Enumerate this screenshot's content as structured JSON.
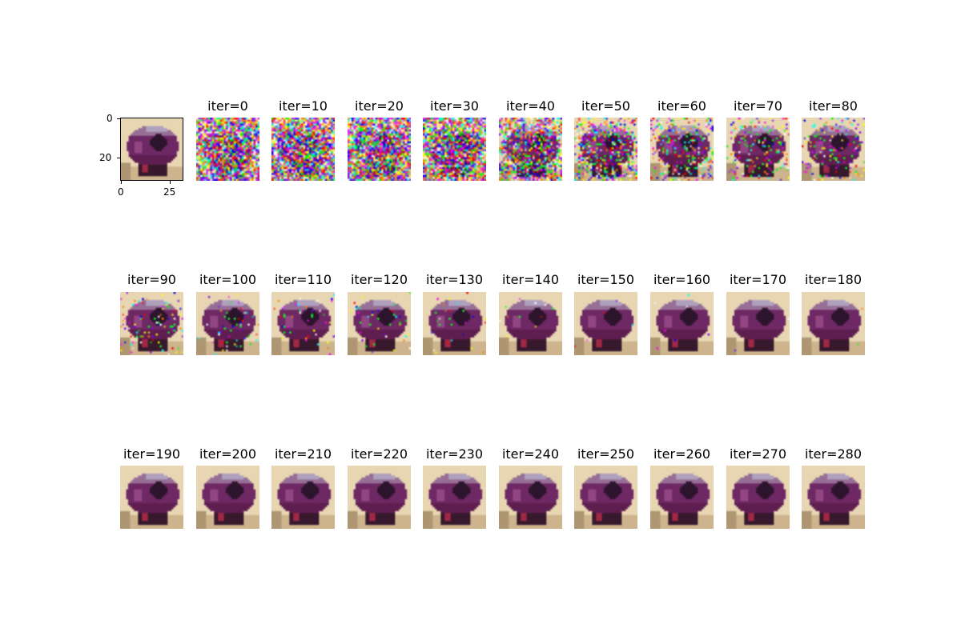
{
  "reference": {
    "y_tick_labels": [
      "0",
      "20"
    ],
    "x_tick_labels": [
      "0",
      "25"
    ]
  },
  "iterations": [
    {
      "label": "iter=0",
      "noise": 1.0,
      "artifacts": 0
    },
    {
      "label": "iter=10",
      "noise": 1.0,
      "artifacts": 0
    },
    {
      "label": "iter=20",
      "noise": 0.98,
      "artifacts": 0
    },
    {
      "label": "iter=30",
      "noise": 0.92,
      "artifacts": 0
    },
    {
      "label": "iter=40",
      "noise": 0.62,
      "artifacts": 40
    },
    {
      "label": "iter=50",
      "noise": 0.42,
      "artifacts": 30
    },
    {
      "label": "iter=60",
      "noise": 0.22,
      "artifacts": 22
    },
    {
      "label": "iter=70",
      "noise": 0.16,
      "artifacts": 18
    },
    {
      "label": "iter=80",
      "noise": 0.12,
      "artifacts": 15
    },
    {
      "label": "iter=90",
      "noise": 0.09,
      "artifacts": 12
    },
    {
      "label": "iter=100",
      "noise": 0.05,
      "artifacts": 10
    },
    {
      "label": "iter=110",
      "noise": 0.04,
      "artifacts": 8
    },
    {
      "label": "iter=120",
      "noise": 0.03,
      "artifacts": 6
    },
    {
      "label": "iter=130",
      "noise": 0.02,
      "artifacts": 4
    },
    {
      "label": "iter=140",
      "noise": 0.01,
      "artifacts": 2
    },
    {
      "label": "iter=150",
      "noise": 0.005,
      "artifacts": 0
    },
    {
      "label": "iter=160",
      "noise": 0.003,
      "artifacts": 0
    },
    {
      "label": "iter=170",
      "noise": 0.002,
      "artifacts": 0
    },
    {
      "label": "iter=180",
      "noise": 0.001,
      "artifacts": 0
    },
    {
      "label": "iter=190",
      "noise": 0,
      "artifacts": 0
    },
    {
      "label": "iter=200",
      "noise": 0,
      "artifacts": 0
    },
    {
      "label": "iter=210",
      "noise": 0,
      "artifacts": 0
    },
    {
      "label": "iter=220",
      "noise": 0,
      "artifacts": 0
    },
    {
      "label": "iter=230",
      "noise": 0,
      "artifacts": 0
    },
    {
      "label": "iter=240",
      "noise": 0,
      "artifacts": 0
    },
    {
      "label": "iter=250",
      "noise": 0,
      "artifacts": 0
    },
    {
      "label": "iter=260",
      "noise": 0,
      "artifacts": 0
    },
    {
      "label": "iter=270",
      "noise": 0,
      "artifacts": 0
    },
    {
      "label": "iter=280",
      "noise": 0,
      "artifacts": 0
    }
  ]
}
